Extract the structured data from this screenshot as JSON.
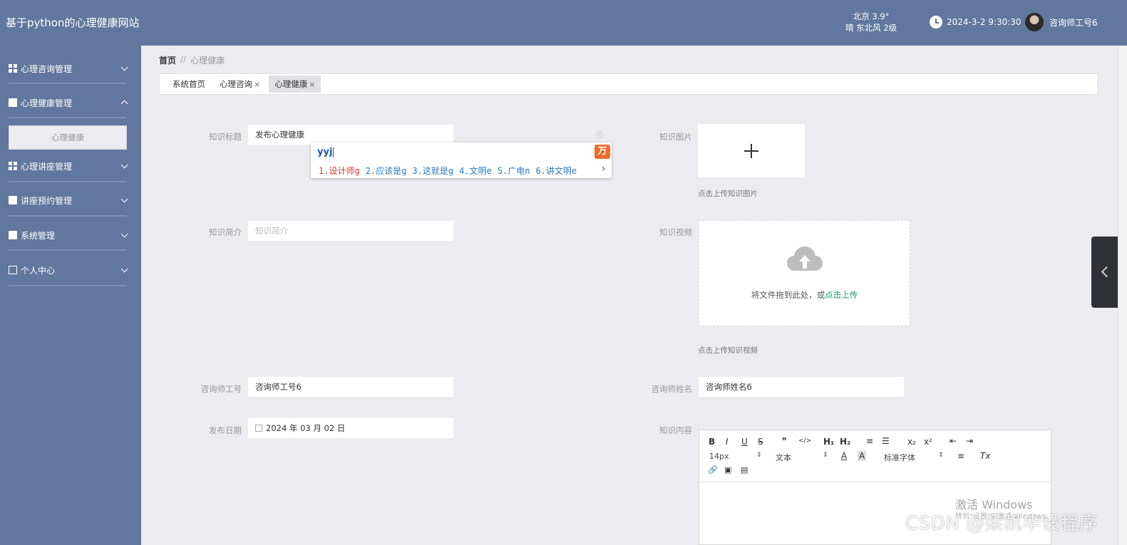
{
  "header": {
    "app_title": "基于python的心理健康网站",
    "weather_city": "北京 3.9°",
    "weather_desc": "晴 东北风 2级",
    "datetime": "2024-3-2 9:30:30",
    "username": "咨询师工号6"
  },
  "sidebar": {
    "items": [
      {
        "label": "心理咨询管理",
        "icon": "grid-icon"
      },
      {
        "label": "心理健康管理",
        "icon": "hand-icon"
      },
      {
        "label": "心理讲座管理",
        "icon": "grid-icon"
      },
      {
        "label": "讲座预约管理",
        "icon": "briefcase-icon"
      },
      {
        "label": "系统管理",
        "icon": "clipboard-icon"
      },
      {
        "label": "个人中心",
        "icon": "card-icon"
      }
    ],
    "submenu_active": "心理健康"
  },
  "breadcrumb": {
    "home": "首页",
    "separator": "//",
    "current": "心理健康"
  },
  "tabs": [
    {
      "label": "系统首页"
    },
    {
      "label": "心理咨询",
      "close": "×"
    },
    {
      "label": "心理健康",
      "close": "×"
    }
  ],
  "form": {
    "title_label": "知识标题",
    "title_value": "发布心理健康",
    "image_label": "知识图片",
    "image_hint": "点击上传知识图片",
    "intro_label": "知识简介",
    "intro_placeholder": "知识简介",
    "video_label": "知识视频",
    "video_drop_text": "将文件拖到此处，或",
    "video_upload_link": "点击上传",
    "video_hint": "点击上传知识视频",
    "counselor_id_label": "咨询师工号",
    "counselor_id_value": "咨询师工号6",
    "counselor_name_label": "咨询师姓名",
    "counselor_name_value": "咨询师姓名6",
    "date_label": "发布日期",
    "date_value": "2024 年 03 月 02 日",
    "content_label": "知识内容"
  },
  "ime": {
    "input": "yyj",
    "logo": "万",
    "candidates": [
      "1.设计师g",
      "2.应该是g",
      "3.这就是g",
      "4.文明e",
      "5.广电n",
      "6.讲文明e"
    ],
    "next": "›"
  },
  "editor": {
    "buttons_row1": [
      "B",
      "I",
      "U",
      "S",
      "❞",
      "</>",
      "H₁",
      "H₂",
      "≡",
      "☰",
      "x₂",
      "x²",
      "⇤",
      "⇥"
    ],
    "font_size": "14px",
    "text_type": "文本",
    "font_family": "标准字体",
    "color_a": "A",
    "bg_a": "A",
    "align": "≡",
    "clear": "Tx",
    "row3": [
      "🔗",
      "▣",
      "▤"
    ]
  },
  "overlay": {
    "activate_windows": "激活 Windows",
    "activate_sub": "转到\"设置\"以激活 Windows。",
    "watermark": "CSDN @梁凯毕设程序"
  }
}
